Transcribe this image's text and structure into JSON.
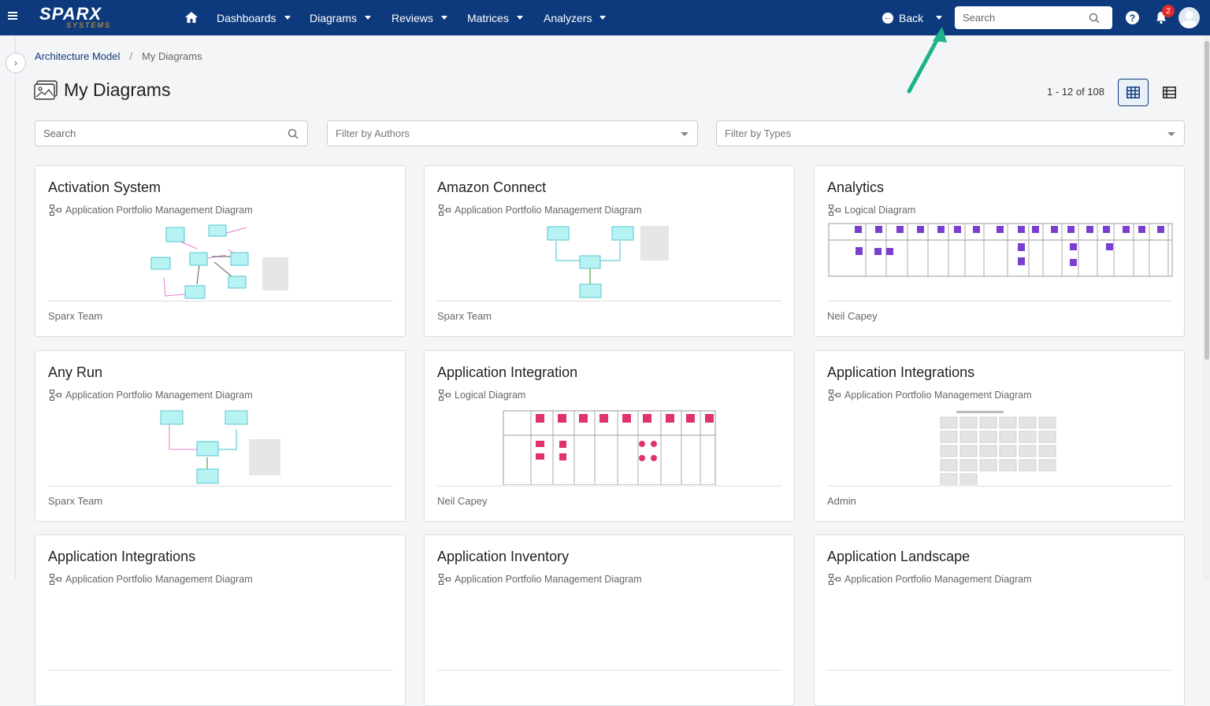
{
  "topbar": {
    "logo_main": "SPARX",
    "logo_sub": "SYSTEMS",
    "nav": [
      {
        "label": "Dashboards"
      },
      {
        "label": "Diagrams"
      },
      {
        "label": "Reviews"
      },
      {
        "label": "Matrices"
      },
      {
        "label": "Analyzers"
      }
    ],
    "back_label": "Back",
    "search_placeholder": "Search",
    "notification_count": "2"
  },
  "breadcrumb": {
    "root": "Architecture Model",
    "separator": "/",
    "current": "My Diagrams"
  },
  "page": {
    "title": "My Diagrams",
    "pager": "1 - 12 of 108"
  },
  "filters": {
    "search_placeholder": "Search",
    "authors_placeholder": "Filter by Authors",
    "types_placeholder": "Filter by Types"
  },
  "cards": [
    {
      "title": "Activation System",
      "type": "Application Portfolio Management Diagram",
      "author": "Sparx Team",
      "thumb": "apm"
    },
    {
      "title": "Amazon Connect",
      "type": "Application Portfolio Management Diagram",
      "author": "Sparx Team",
      "thumb": "apm2"
    },
    {
      "title": "Analytics",
      "type": "Logical Diagram",
      "author": "Neil Capey",
      "thumb": "logical-purple"
    },
    {
      "title": "Any Run",
      "type": "Application Portfolio Management Diagram",
      "author": "Sparx Team",
      "thumb": "apm3"
    },
    {
      "title": "Application Integration",
      "type": "Logical Diagram",
      "author": "Neil Capey",
      "thumb": "logical-pink"
    },
    {
      "title": "Application Integrations",
      "type": "Application Portfolio Management Diagram",
      "author": "Admin",
      "thumb": "grid"
    },
    {
      "title": "Application Integrations",
      "type": "Application Portfolio Management Diagram",
      "author": "",
      "thumb": "none"
    },
    {
      "title": "Application Inventory",
      "type": "Application Portfolio Management Diagram",
      "author": "",
      "thumb": "none"
    },
    {
      "title": "Application Landscape",
      "type": "Application Portfolio Management Diagram",
      "author": "",
      "thumb": "none"
    }
  ],
  "colors": {
    "topbar": "#0d3a7d",
    "accent": "#0d3a7d",
    "badge": "#e02b2b",
    "annotation_arrow": "#1db38a"
  }
}
